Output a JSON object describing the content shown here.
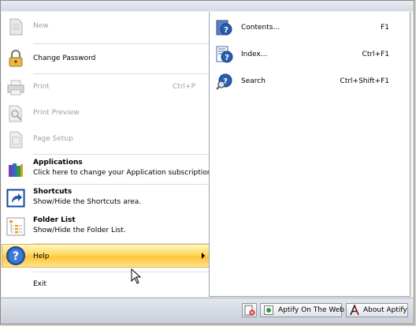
{
  "menu": {
    "items": [
      {
        "label": "New",
        "shortcut": "",
        "disabled": true,
        "icon": "new-document-icon"
      },
      {
        "label": "Change Password",
        "shortcut": "",
        "disabled": false,
        "icon": "lock-icon"
      },
      {
        "label": "Print",
        "shortcut": "Ctrl+P",
        "disabled": true,
        "icon": "printer-icon"
      },
      {
        "label": "Print Preview",
        "shortcut": "",
        "disabled": true,
        "icon": "print-preview-icon"
      },
      {
        "label": "Page Setup",
        "shortcut": "",
        "disabled": true,
        "icon": "page-setup-icon"
      }
    ],
    "applications": {
      "title": "Applications",
      "description": "Click here to change your Application subscriptions.",
      "icon": "applications-books-icon"
    },
    "shortcuts": {
      "title": "Shortcuts",
      "description": "Show/Hide the Shortcuts area.",
      "icon": "shortcut-arrow-icon"
    },
    "folder_list": {
      "title": "Folder List",
      "description": "Show/Hide the Folder List.",
      "icon": "folder-tree-icon"
    },
    "help": {
      "label": "Help",
      "icon": "help-question-icon"
    },
    "exit": {
      "label": "Exit"
    }
  },
  "help_submenu": [
    {
      "label": "Contents...",
      "shortcut": "F1",
      "icon": "help-contents-icon"
    },
    {
      "label": "Index...",
      "shortcut": "Ctrl+F1",
      "icon": "help-index-icon"
    },
    {
      "label": "Search",
      "shortcut": "Ctrl+Shift+F1",
      "icon": "help-search-icon"
    }
  ],
  "statusbar": {
    "web_label": "Aptify On The Web",
    "about_label": "About Aptify"
  },
  "colors": {
    "highlight": "#ffd95c",
    "accent": "#2a5db0"
  }
}
